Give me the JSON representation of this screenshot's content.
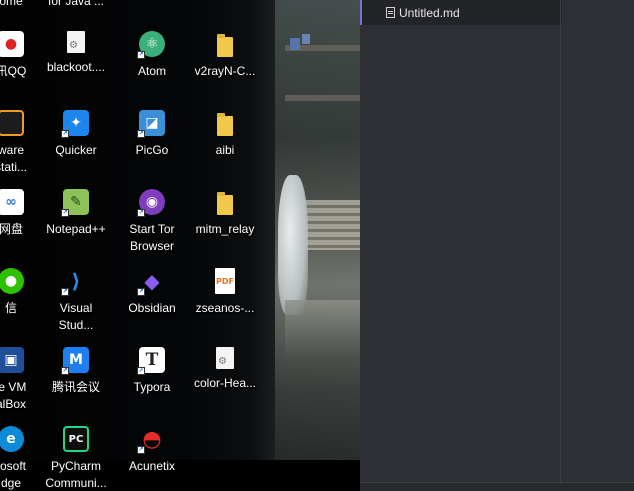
{
  "desktop": {
    "icons": [
      {
        "label": "ome",
        "name": "chrome-icon"
      },
      {
        "label": "for Java ...",
        "name": "java-tool-icon"
      },
      {
        "label": "讯QQ",
        "name": "qq-icon"
      },
      {
        "label": "blackoot....",
        "name": "blackoot-file-icon"
      },
      {
        "label": "Atom",
        "name": "atom-icon"
      },
      {
        "label": "v2rayN-C...",
        "name": "folder-icon"
      },
      {
        "label": "ware\nstati...",
        "name": "vmware-icon"
      },
      {
        "label": "Quicker",
        "name": "quicker-icon"
      },
      {
        "label": "PicGo",
        "name": "picgo-icon"
      },
      {
        "label": "aibi",
        "name": "folder-icon"
      },
      {
        "label": "网盘",
        "name": "baidu-netdisk-icon"
      },
      {
        "label": "Notepad++",
        "name": "notepadpp-icon"
      },
      {
        "label": "Start Tor\nBrowser",
        "name": "tor-browser-icon"
      },
      {
        "label": "mitm_relay",
        "name": "folder-icon"
      },
      {
        "label": "信",
        "name": "wechat-icon"
      },
      {
        "label": "Visual\nStud...",
        "name": "vscode-icon"
      },
      {
        "label": "Obsidian",
        "name": "obsidian-icon"
      },
      {
        "label": "zseanos-...",
        "name": "pdf-file-icon"
      },
      {
        "label": "le VM\nalBox",
        "name": "virtualbox-icon"
      },
      {
        "label": "腾讯会议",
        "name": "tencent-meeting-icon"
      },
      {
        "label": "Typora",
        "name": "typora-icon"
      },
      {
        "label": "color-Hea...",
        "name": "config-file-icon"
      },
      {
        "label": "rosoft\ndge",
        "name": "edge-icon"
      },
      {
        "label": "PyCharm\nCommuni...",
        "name": "pycharm-icon"
      },
      {
        "label": "Acunetix",
        "name": "acunetix-icon"
      }
    ]
  },
  "editor": {
    "tab_label": "Untitled.md"
  },
  "colors": {
    "editor_bg": "#2e2f35",
    "accent": "#7b6fe0",
    "folder": "#f1c84c"
  }
}
